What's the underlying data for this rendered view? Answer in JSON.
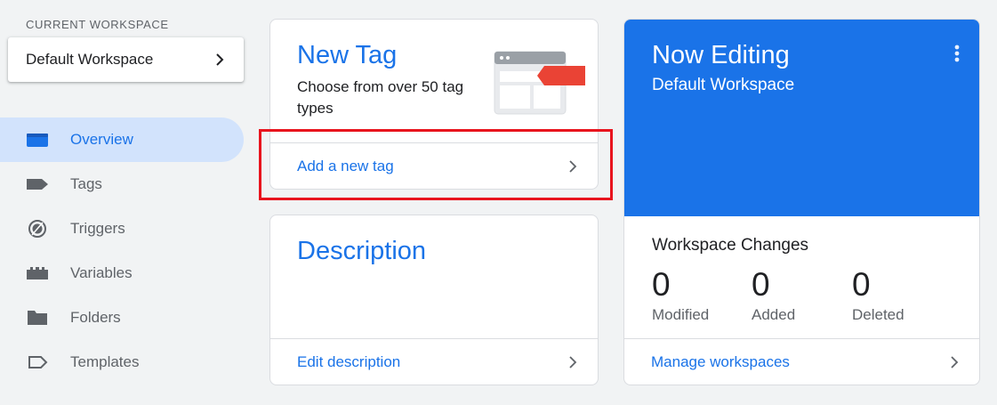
{
  "sidebar": {
    "workspace_label": "CURRENT WORKSPACE",
    "workspace_name": "Default Workspace",
    "items": [
      {
        "label": "Overview",
        "icon": "overview-icon",
        "active": true
      },
      {
        "label": "Tags",
        "icon": "tag-icon"
      },
      {
        "label": "Triggers",
        "icon": "trigger-icon"
      },
      {
        "label": "Variables",
        "icon": "variables-icon"
      },
      {
        "label": "Folders",
        "icon": "folder-icon"
      },
      {
        "label": "Templates",
        "icon": "template-icon"
      }
    ]
  },
  "new_tag_card": {
    "title": "New Tag",
    "subtitle": "Choose from over 50 tag types",
    "link": "Add a new tag",
    "illustration": "tag-illustration"
  },
  "description_card": {
    "title": "Description",
    "link": "Edit description"
  },
  "editing_card": {
    "title": "Now Editing",
    "workspace": "Default Workspace",
    "changes_title": "Workspace Changes",
    "stats": [
      {
        "value": "0",
        "label": "Modified"
      },
      {
        "value": "0",
        "label": "Added"
      },
      {
        "value": "0",
        "label": "Deleted"
      }
    ],
    "link": "Manage workspaces"
  },
  "colors": {
    "accent": "#1a73e8",
    "active_nav_bg": "#d2e3fc",
    "highlight": "#e8141e",
    "tag_red": "#ea4335"
  }
}
